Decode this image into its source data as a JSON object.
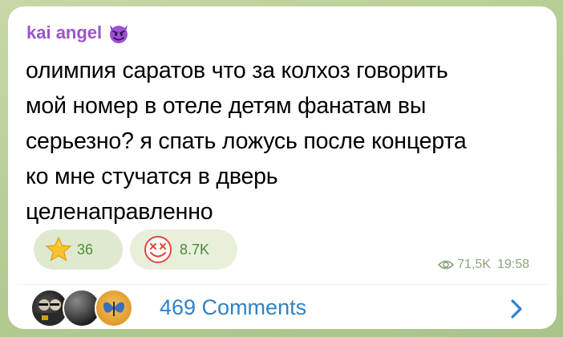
{
  "post": {
    "author": "kai angel",
    "author_emoji": "devil-emoji",
    "text": "олимпия саратов что за колхоз говорить\nмой номер в отеле детям фанатам вы\nсерьезно? я спать ложусь после концерта\nко мне стучатся в дверь\nцеленаправленно",
    "reactions": [
      {
        "icon": "star-icon",
        "count": "36"
      },
      {
        "icon": "smiley-face-icon",
        "count": "8.7K"
      }
    ],
    "views": "71,5K",
    "time": "19:58"
  },
  "comments": {
    "label": "469 Comments"
  },
  "colors": {
    "author": "#9a55c9",
    "link": "#2f82c7",
    "meta": "#8da37f"
  }
}
